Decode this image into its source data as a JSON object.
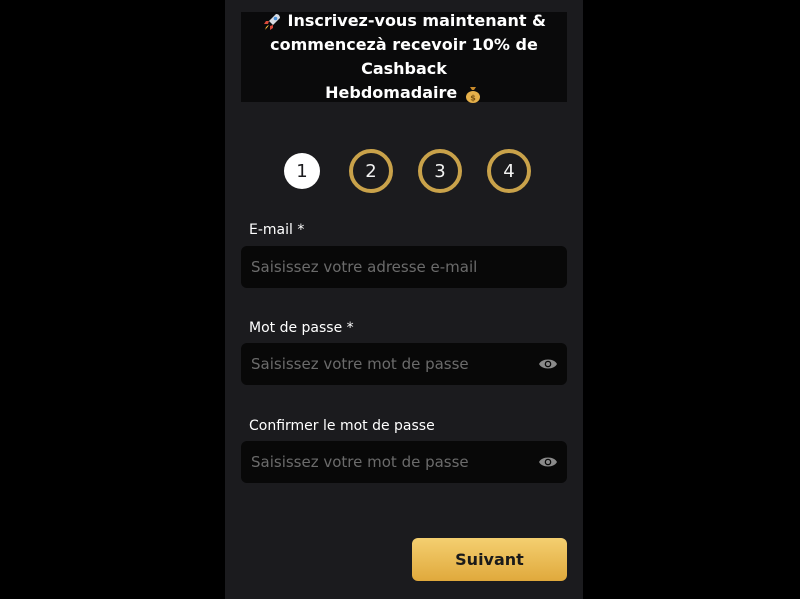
{
  "banner": {
    "line1": "Inscrivez-vous maintenant &",
    "line2": "commencezà recevoir 10% de Cashback",
    "line3": "Hebdomadaire",
    "leading_icon": "rocket-emoji",
    "trailing_icon": "money-bag-emoji"
  },
  "steps": [
    {
      "label": "1",
      "state": "active"
    },
    {
      "label": "2",
      "state": "pending"
    },
    {
      "label": "3",
      "state": "pending"
    },
    {
      "label": "4",
      "state": "pending"
    }
  ],
  "form": {
    "email": {
      "label": "E-mail *",
      "placeholder": "Saisissez votre adresse e-mail",
      "value": ""
    },
    "password": {
      "label": "Mot de passe *",
      "placeholder": "Saisissez votre mot de passe",
      "value": "",
      "toggle_icon": "eye-icon"
    },
    "confirm": {
      "label": "Confirmer le mot de passe",
      "placeholder": "Saisissez votre mot de passe",
      "value": "",
      "toggle_icon": "eye-icon"
    }
  },
  "actions": {
    "next_label": "Suivant"
  },
  "colors": {
    "accent_gold": "#c9a24a",
    "button_gradient_top": "#f4cf70",
    "button_gradient_bottom": "#e0a93c",
    "panel_bg": "#1b1b1e",
    "field_bg": "#080808"
  }
}
